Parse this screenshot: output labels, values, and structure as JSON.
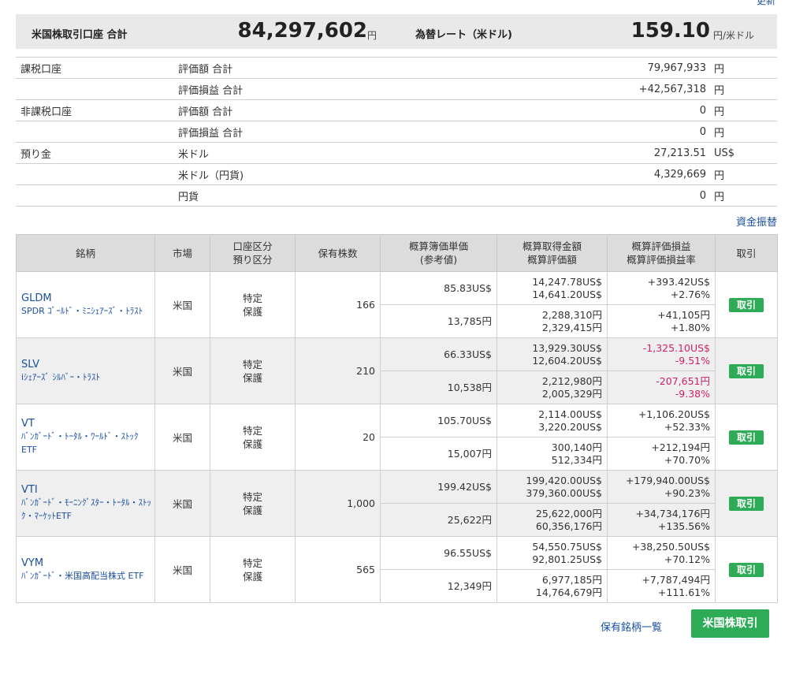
{
  "summary": {
    "label": "米国株取引口座 合計",
    "total": "84,297,602",
    "total_unit": "円",
    "rate_label": "為替レート（米ドル)",
    "rate": "159.10",
    "rate_unit": "円/米ドル"
  },
  "accounts": [
    {
      "category": "課税口座",
      "item": "評価額 合計",
      "value": "79,967,933",
      "unit": "円"
    },
    {
      "category": "",
      "item": "評価損益 合計",
      "value": "+42,567,318",
      "unit": "円"
    },
    {
      "category": "非課税口座",
      "item": "評価額 合計",
      "value": "0",
      "unit": "円"
    },
    {
      "category": "",
      "item": "評価損益 合計",
      "value": "0",
      "unit": "円"
    },
    {
      "category": "預り金",
      "item": "米ドル",
      "value": "27,213.51",
      "unit": "US$"
    },
    {
      "category": "",
      "item": "米ドル（円貨)",
      "value": "4,329,669",
      "unit": "円"
    },
    {
      "category": "",
      "item": "円貨",
      "value": "0",
      "unit": "円"
    }
  ],
  "transfer_link": "資金振替",
  "holdings_headers": {
    "name": "銘柄",
    "market": "市場",
    "account_type_1": "口座区分",
    "account_type_2": "預り区分",
    "qty": "保有株数",
    "avg_price_1": "概算簿価単価",
    "avg_price_2": "(参考値)",
    "cost_1": "概算取得金額",
    "cost_2": "概算評価額",
    "pl_1": "概算評価損益",
    "pl_2": "概算評価損益率",
    "trade": "取引"
  },
  "holdings": [
    {
      "ticker": "GLDM",
      "fund": "SPDR ｺﾞｰﾙﾄﾞ・ﾐﾆｼｪｱｰｽﾞ・ﾄﾗｽﾄ",
      "market": "米国",
      "acct1": "特定",
      "acct2": "保護",
      "qty": "166",
      "usd_price": "85.83US$",
      "usd_cost": "14,247.78US$",
      "usd_value": "14,641.20US$",
      "usd_pl": "+393.42US$",
      "usd_pl_rate": "+2.76%",
      "jpy_price": "13,785円",
      "jpy_cost": "2,288,310円",
      "jpy_value": "2,329,415円",
      "jpy_pl": "+41,105円",
      "jpy_pl_rate": "+1.80%",
      "trade": "取引"
    },
    {
      "ticker": "SLV",
      "fund": "iｼｪｱｰｽﾞ ｼﾙﾊﾞｰ・ﾄﾗｽﾄ",
      "market": "米国",
      "acct1": "特定",
      "acct2": "保護",
      "qty": "210",
      "usd_price": "66.33US$",
      "usd_cost": "13,929.30US$",
      "usd_value": "12,604.20US$",
      "usd_pl": "-1,325.10US$",
      "usd_pl_rate": "-9.51%",
      "jpy_price": "10,538円",
      "jpy_cost": "2,212,980円",
      "jpy_value": "2,005,329円",
      "jpy_pl": "-207,651円",
      "jpy_pl_rate": "-9.38%",
      "trade": "取引"
    },
    {
      "ticker": "VT",
      "fund": "ﾊﾞﾝｶﾞｰﾄﾞ・ﾄｰﾀﾙ・ﾜｰﾙﾄﾞ・ｽﾄｯｸ ETF",
      "market": "米国",
      "acct1": "特定",
      "acct2": "保護",
      "qty": "20",
      "usd_price": "105.70US$",
      "usd_cost": "2,114.00US$",
      "usd_value": "3,220.20US$",
      "usd_pl": "+1,106.20US$",
      "usd_pl_rate": "+52.33%",
      "jpy_price": "15,007円",
      "jpy_cost": "300,140円",
      "jpy_value": "512,334円",
      "jpy_pl": "+212,194円",
      "jpy_pl_rate": "+70.70%",
      "trade": "取引"
    },
    {
      "ticker": "VTI",
      "fund": "ﾊﾞﾝｶﾞｰﾄﾞ・ﾓｰﾆﾝｸﾞｽﾀｰ・ﾄｰﾀﾙ・ｽﾄｯｸ・ﾏｰｹｯﾄETF",
      "market": "米国",
      "acct1": "特定",
      "acct2": "保護",
      "qty": "1,000",
      "usd_price": "199.42US$",
      "usd_cost": "199,420.00US$",
      "usd_value": "379,360.00US$",
      "usd_pl": "+179,940.00US$",
      "usd_pl_rate": "+90.23%",
      "jpy_price": "25,622円",
      "jpy_cost": "25,622,000円",
      "jpy_value": "60,356,176円",
      "jpy_pl": "+34,734,176円",
      "jpy_pl_rate": "+135.56%",
      "trade": "取引"
    },
    {
      "ticker": "VYM",
      "fund": "ﾊﾞﾝｶﾞｰﾄﾞ・米国高配当株式 ETF",
      "market": "米国",
      "acct1": "特定",
      "acct2": "保護",
      "qty": "565",
      "usd_price": "96.55US$",
      "usd_cost": "54,550.75US$",
      "usd_value": "92,801.25US$",
      "usd_pl": "+38,250.50US$",
      "usd_pl_rate": "+70.12%",
      "jpy_price": "12,349円",
      "jpy_cost": "6,977,185円",
      "jpy_value": "14,764,679円",
      "jpy_pl": "+7,787,494円",
      "jpy_pl_rate": "+111.61%",
      "trade": "取引"
    }
  ],
  "holdings_list_link": "保有銘柄一覧",
  "us_stock_trade_button": "米国株取引",
  "top_update_link": "更新",
  "colors": {
    "link": "#1a4fa0",
    "button": "#2eab57",
    "negative": "#d0206a"
  }
}
